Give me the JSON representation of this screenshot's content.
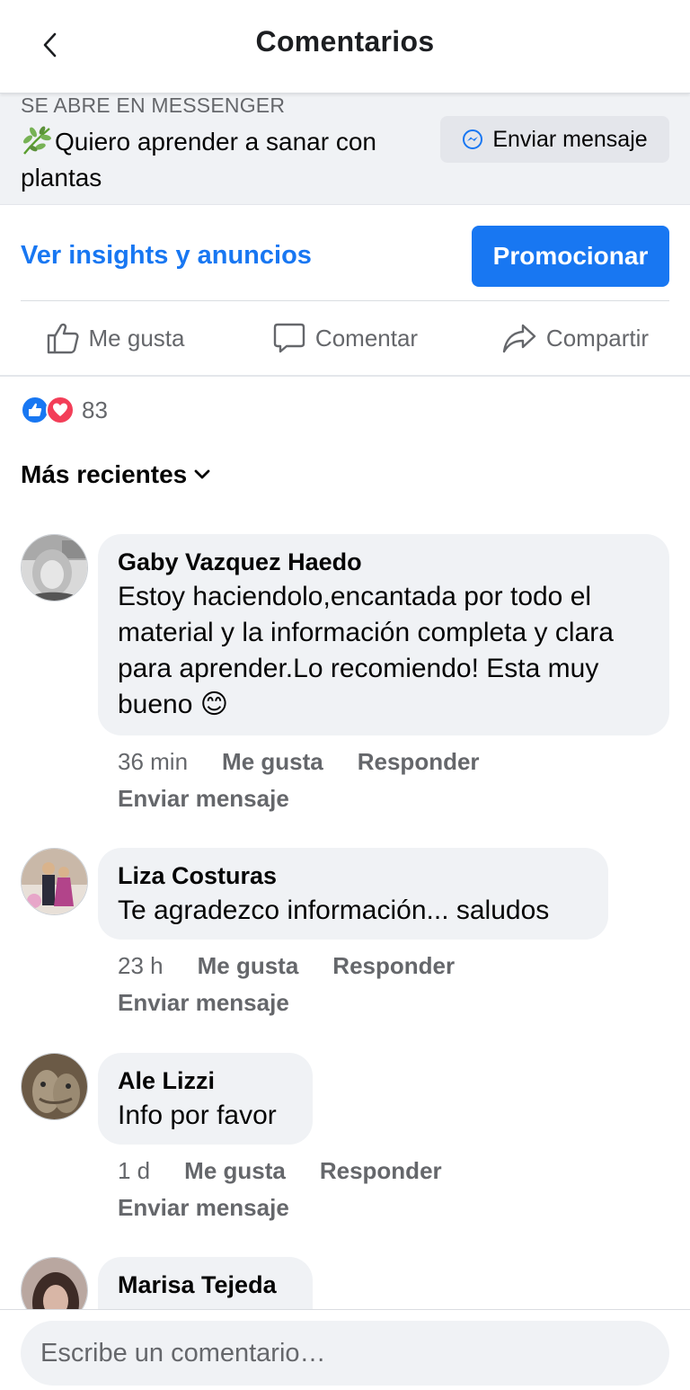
{
  "header": {
    "title": "Comentarios",
    "back_icon": "chevron-left-icon"
  },
  "messenger": {
    "caption": "SE ABRE EN MESSENGER",
    "text": "Quiero aprender a sanar con plantas",
    "leaf_icon": "herb-emoji",
    "button_label": "Enviar mensaje",
    "button_icon": "messenger-icon"
  },
  "insights": {
    "link": "Ver insights y anuncios",
    "promote": "Promocionar",
    "accent": "#1877f2"
  },
  "actions": {
    "like": "Me gusta",
    "comment": "Comentar",
    "share": "Compartir"
  },
  "reactions": {
    "count": "83",
    "types": [
      "like",
      "love"
    ]
  },
  "sort": {
    "label": "Más recientes"
  },
  "comments": [
    {
      "author": "Gaby Vazquez Haedo",
      "text": "Estoy haciendolo,encantada por todo el material y la información completa y clara para aprender.Lo recomiendo! Esta muy bueno",
      "emoji": "😊",
      "time": "36 min",
      "like": "Me gusta",
      "reply": "Responder",
      "message": "Enviar mensaje"
    },
    {
      "author": "Liza Costuras",
      "text": "Te agradezco información... saludos",
      "time": "23 h",
      "like": "Me gusta",
      "reply": "Responder",
      "message": "Enviar mensaje"
    },
    {
      "author": "Ale Lizzi",
      "text": "Info por favor",
      "time": "1 d",
      "like": "Me gusta",
      "reply": "Responder",
      "message": "Enviar mensaje"
    },
    {
      "author": "Marisa Tejeda"
    }
  ],
  "composer": {
    "placeholder": "Escribe un comentario…"
  }
}
